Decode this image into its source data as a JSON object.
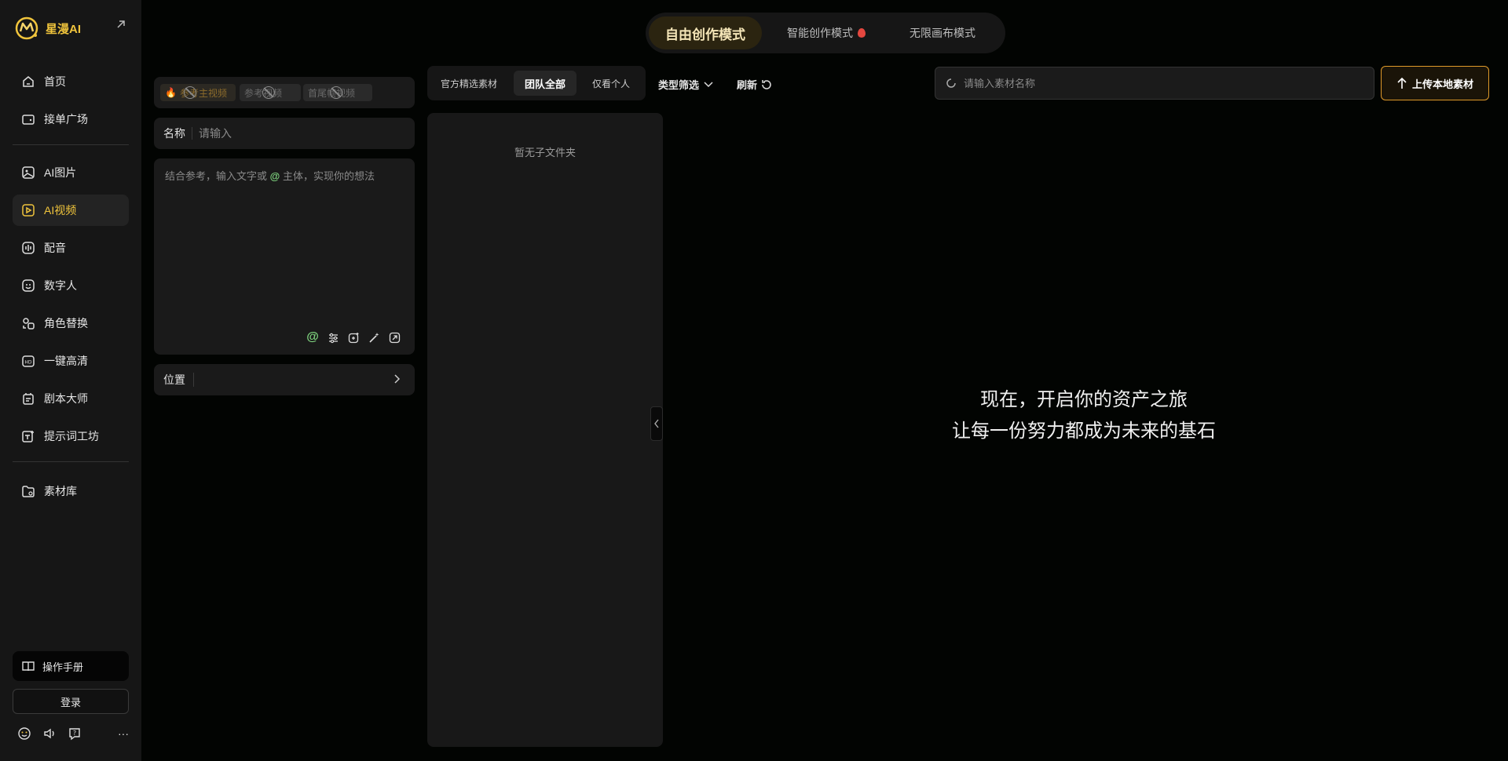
{
  "app": {
    "logo_text": "星漫AI"
  },
  "sidebar": {
    "items": [
      {
        "label": "首页",
        "icon": "home-icon"
      },
      {
        "label": "接单广场",
        "icon": "wallet-icon"
      },
      {
        "label": "AI图片",
        "icon": "image-icon"
      },
      {
        "label": "AI视频",
        "icon": "video-icon",
        "active": true
      },
      {
        "label": "配音",
        "icon": "audio-icon"
      },
      {
        "label": "数字人",
        "icon": "face-icon"
      },
      {
        "label": "角色替换",
        "icon": "swap-icon"
      },
      {
        "label": "一键高清",
        "icon": "hd-icon"
      },
      {
        "label": "剧本大师",
        "icon": "script-icon"
      },
      {
        "label": "提示词工坊",
        "icon": "prompt-icon"
      },
      {
        "label": "素材库",
        "icon": "folder-icon"
      }
    ],
    "manual_label": "操作手册",
    "login_label": "登录"
  },
  "modes": {
    "free": "自由创作模式",
    "smart": "智能创作模式",
    "canvas": "无限画布模式"
  },
  "ref_chips": [
    "参考主视频",
    "参考视频",
    "首尾帧视频"
  ],
  "name_field": {
    "label": "名称",
    "placeholder": "请输入"
  },
  "prompt": {
    "before": "结合参考，输入文字或",
    "at": "@",
    "after": "主体，实现你的想法"
  },
  "position_field": {
    "label": "位置"
  },
  "filter_tabs": [
    "官方精选素材",
    "团队全部",
    "仅看个人"
  ],
  "type_filter": "类型筛选",
  "refresh": "刷新",
  "folder_empty": "暂无子文件夹",
  "search": {
    "placeholder": "请输入素材名称"
  },
  "upload_label": "上传本地素材",
  "empty_state": {
    "line1": "现在，开启你的资产之旅",
    "line2": "让每一份努力都成为未来的基石"
  },
  "colors": {
    "accent": "#f0c43c",
    "upload_border": "#e09a2a",
    "at_green": "#7ed27e",
    "fire": "#e4473f"
  }
}
